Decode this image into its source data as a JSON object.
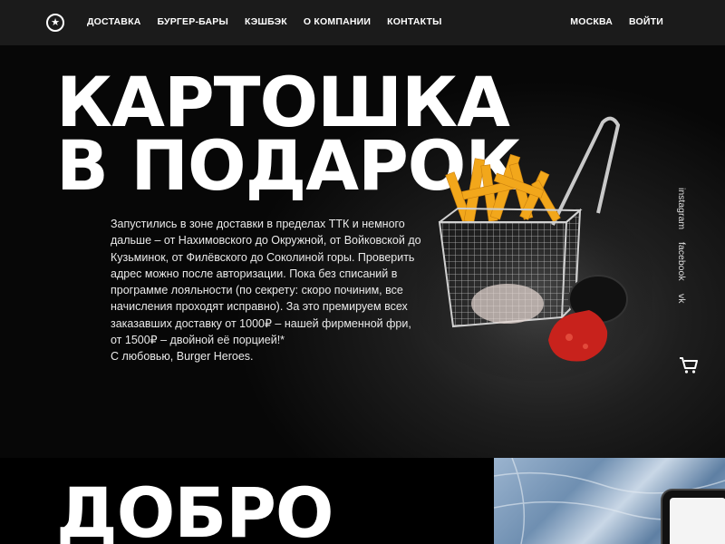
{
  "header": {
    "logo_icon": "star-circle-icon",
    "nav": [
      "ДОСТАВКА",
      "БУРГЕР-БАРЫ",
      "КЭШБЭК",
      "О КОМПАНИИ",
      "КОНТАКТЫ"
    ],
    "city": "МОСКВА",
    "login": "ВОЙТИ"
  },
  "hero": {
    "title_line1": "КАРТОШКА",
    "title_line2": "В ПОДАРОК",
    "body": [
      "Запустились в зоне доставки в пределах ТТК и немного дальше – от Нахимовского до Окружной, от Войковской до Кузьминок, от Филёвского до Соколиной горы. Проверить адрес можно после авторизации. Пока без списаний в программе лояльности (по секрету: скоро починим, все начисления проходят исправно). За это премируем всех заказавших доставку от 1000₽ – нашей фирменной фри, от 1500₽ – двойной её порцией!*",
      "С любовью, Burger Heroes."
    ]
  },
  "social": [
    "instagram",
    "facebook",
    "vk"
  ],
  "cart_icon": "cart-icon",
  "section2": {
    "title": "ДОБРО"
  },
  "colors": {
    "background": "#000000",
    "header": "#1b1b1b",
    "text": "#ffffff",
    "ketchup": "#c8221c",
    "fries": "#f2a71b"
  }
}
